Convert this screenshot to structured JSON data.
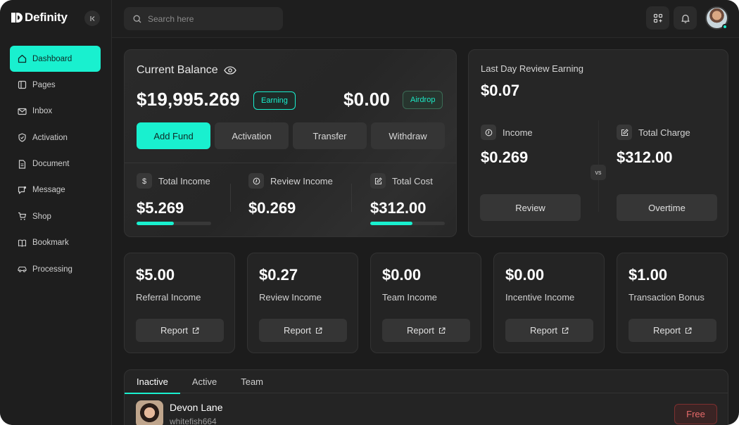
{
  "brand": {
    "name": "Definity"
  },
  "sidebar": {
    "items": [
      {
        "label": "Dashboard",
        "icon": "home-icon",
        "active": true
      },
      {
        "label": "Pages",
        "icon": "pages-icon",
        "active": false
      },
      {
        "label": "Inbox",
        "icon": "mail-icon",
        "active": false
      },
      {
        "label": "Activation",
        "icon": "shield-check-icon",
        "active": false
      },
      {
        "label": "Document",
        "icon": "document-icon",
        "active": false
      },
      {
        "label": "Message",
        "icon": "message-icon",
        "active": false
      },
      {
        "label": "Shop",
        "icon": "cart-icon",
        "active": false
      },
      {
        "label": "Bookmark",
        "icon": "book-icon",
        "active": false
      },
      {
        "label": "Processing",
        "icon": "car-icon",
        "active": false
      }
    ]
  },
  "topbar": {
    "search_placeholder": "Search here"
  },
  "balance": {
    "title": "Current Balance",
    "amount": "$19,995.269",
    "earning_label": "Earning",
    "airdrop_amount": "$0.00",
    "airdrop_label": "Airdrop",
    "actions": [
      "Add Fund",
      "Activation",
      "Transfer",
      "Withdraw"
    ],
    "stats": [
      {
        "label": "Total Income",
        "value": "$5.269",
        "icon": "dollar-icon",
        "progress": 0.5
      },
      {
        "label": "Review Income",
        "value": "$0.269",
        "icon": "clock-icon"
      },
      {
        "label": "Total Cost",
        "value": "$312.00",
        "icon": "edit-icon",
        "progress": 0.57
      }
    ]
  },
  "review": {
    "title": "Last Day Review Earning",
    "amount": "$0.07",
    "income_label": "Income",
    "income_value": "$0.269",
    "charge_label": "Total Charge",
    "charge_value": "$312.00",
    "vs_label": "vs",
    "review_button": "Review",
    "overtime_button": "Overtime"
  },
  "mini_cards": [
    {
      "amount": "$5.00",
      "label": "Referral Income",
      "button": "Report"
    },
    {
      "amount": "$0.27",
      "label": "Review Income",
      "button": "Report"
    },
    {
      "amount": "$0.00",
      "label": "Team Income",
      "button": "Report"
    },
    {
      "amount": "$0.00",
      "label": "Incentive Income",
      "button": "Report"
    },
    {
      "amount": "$1.00",
      "label": "Transaction Bonus",
      "button": "Report"
    }
  ],
  "tabs": [
    "Inactive",
    "Active",
    "Team"
  ],
  "user_row": {
    "name": "Devon Lane",
    "handle": "whitefish664",
    "badge": "Free"
  },
  "colors": {
    "accent": "#19f0cf",
    "background": "#1c1c1c",
    "card": "#242424",
    "danger": "#e66a6a"
  }
}
